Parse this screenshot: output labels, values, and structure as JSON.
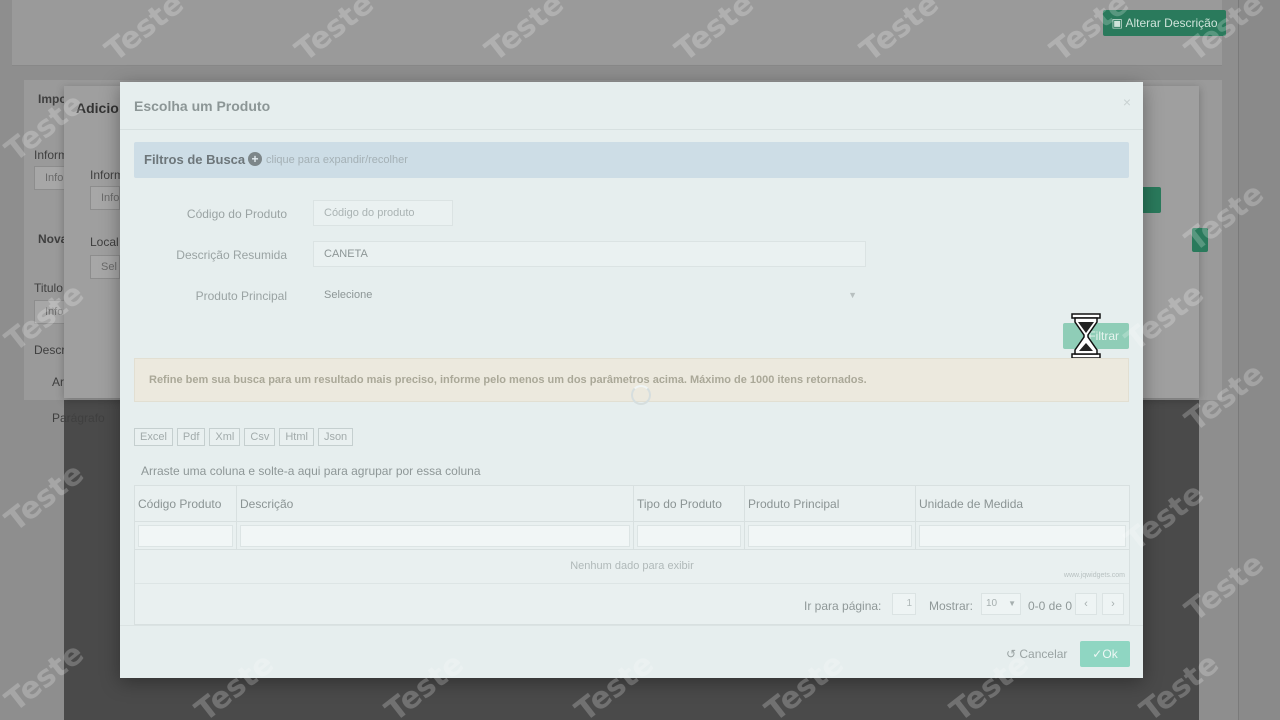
{
  "background": {
    "alter_description_button": "Alterar Descrição",
    "left_labels": [
      "Impo",
      "Inform",
      "Info",
      "Nova",
      "Titulo",
      "Info",
      "Descr",
      "Ar",
      "Parágrafo"
    ],
    "mid_modal": {
      "title": "Adicio",
      "labels": [
        "Inform",
        "Info",
        "Local",
        "Sel"
      ]
    }
  },
  "modal": {
    "title": "Escolha um Produto",
    "close_icon": "×",
    "filters": {
      "title": "Filtros de Busca",
      "plus_icon": "+",
      "hint": "clique para expandir/recolher"
    },
    "fields": {
      "codigo_label": "Código do Produto",
      "codigo_placeholder": "Código do produto",
      "descricao_label": "Descrição Resumida",
      "descricao_value": "CANETA",
      "principal_label": "Produto Principal",
      "principal_value": "Selecione"
    },
    "filter_button": "Filtrar",
    "alert": "Refine bem sua busca para um resultado mais preciso, informe pelo menos um dos parâmetros acima. Máximo de 1000 itens retornados.",
    "export_buttons": [
      "Excel",
      "Pdf",
      "Xml",
      "Csv",
      "Html",
      "Json"
    ],
    "group_hint": "Arraste uma coluna e solte-a aqui para agrupar por essa coluna",
    "grid": {
      "columns": [
        "Código Produto",
        "Descrição",
        "Tipo do Produto",
        "Produto Principal",
        "Unidade de Medida"
      ],
      "empty_text": "Nenhum dado para exibir",
      "credit": "www.jqwidgets.com",
      "pager": {
        "go_to_label": "Ir para página:",
        "page_value": "1",
        "show_label": "Mostrar:",
        "page_size": "10",
        "range_text": "0-0 de 0",
        "prev_icon": "‹",
        "next_icon": "›"
      }
    },
    "footer": {
      "cancel": "Cancelar",
      "ok": "Ok"
    }
  },
  "watermark": "Teste"
}
